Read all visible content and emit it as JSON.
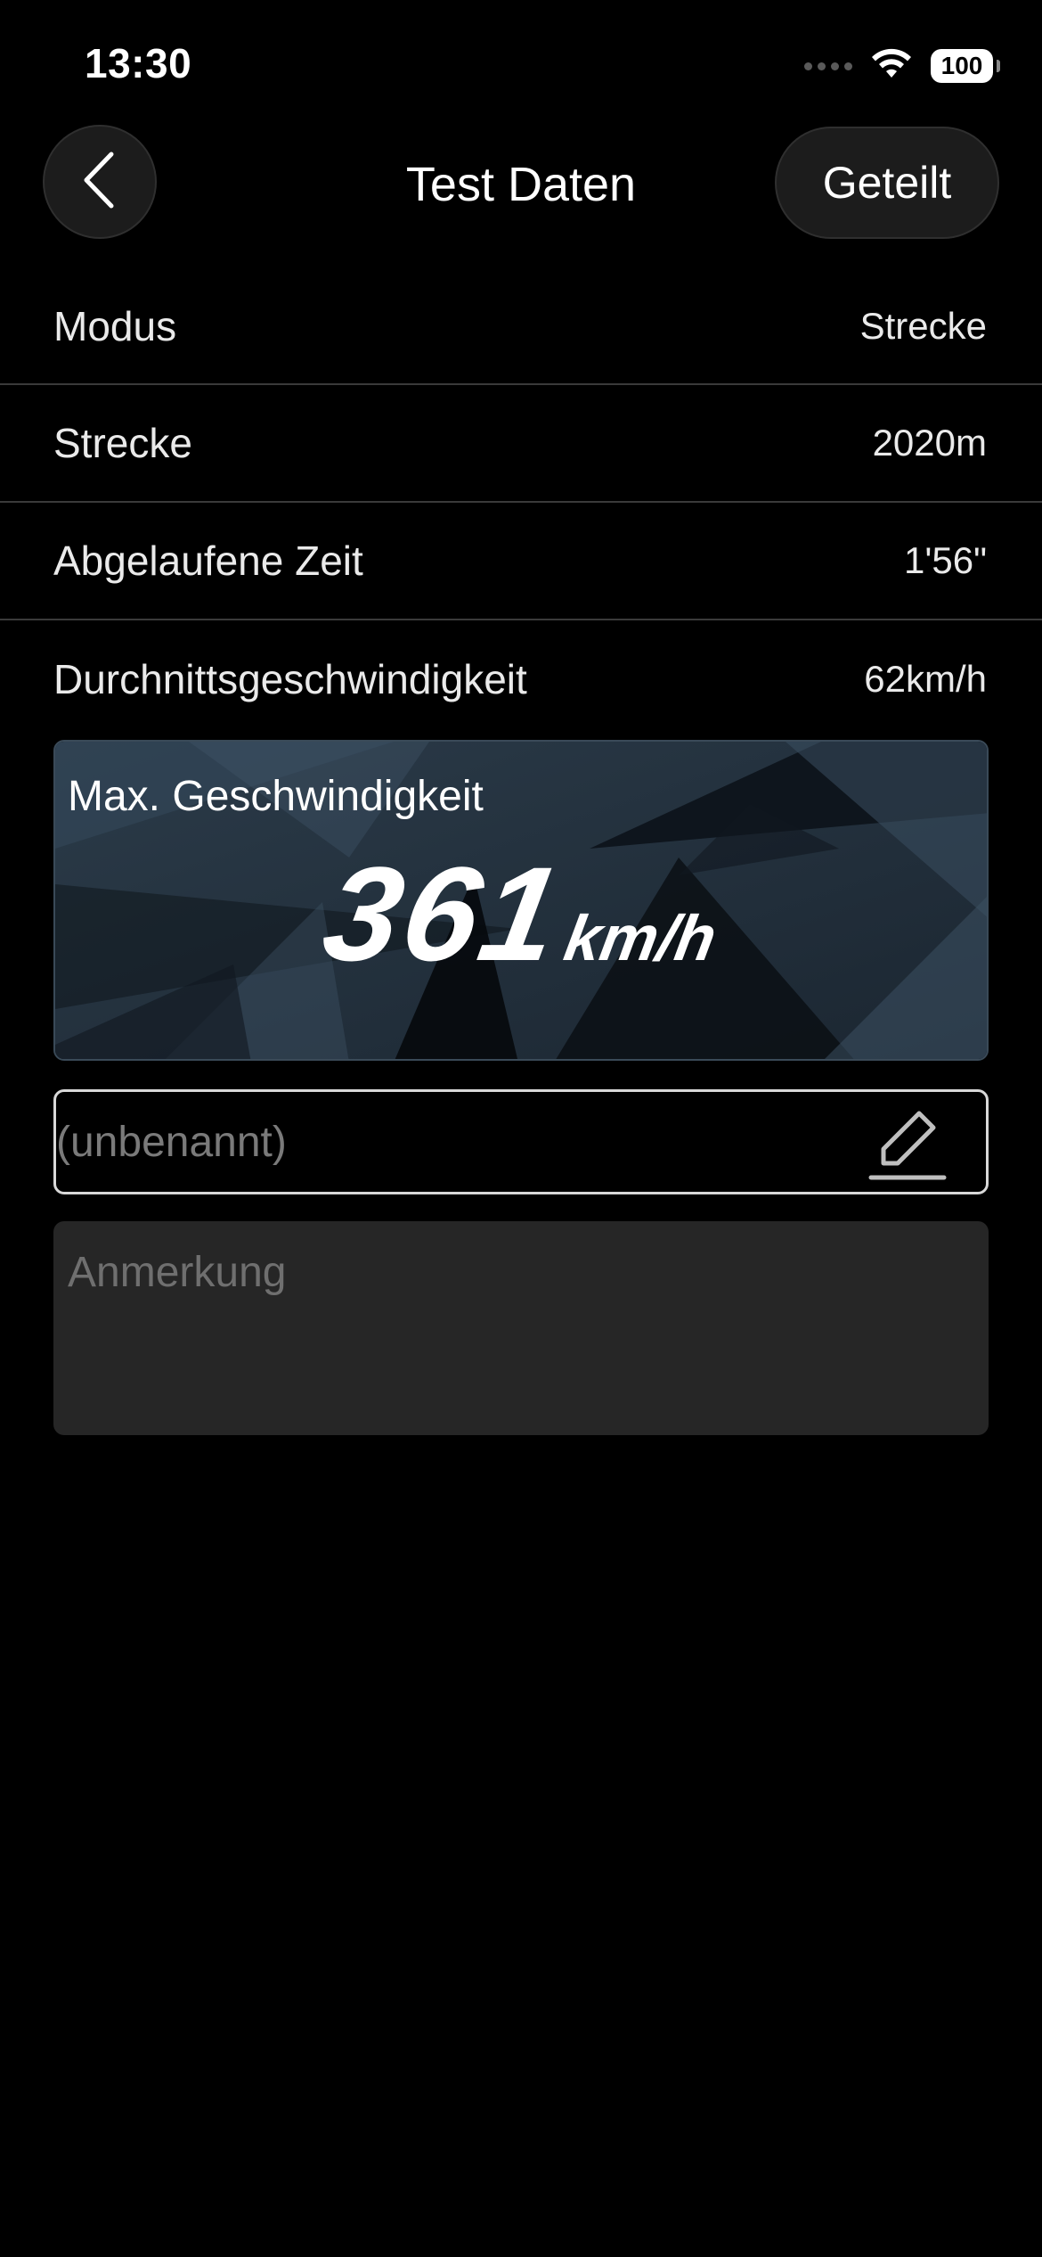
{
  "status_bar": {
    "time": "13:30",
    "battery": "100"
  },
  "nav": {
    "title": "Test Daten",
    "share_label": "Geteilt"
  },
  "rows": [
    {
      "label": "Modus",
      "value": "Strecke"
    },
    {
      "label": "Strecke",
      "value": "2020m"
    },
    {
      "label": "Abgelaufene Zeit",
      "value": "1'56\""
    },
    {
      "label": "Durchnittsgeschwindigkeit",
      "value": "62km/h"
    }
  ],
  "max_speed": {
    "label": "Max. Geschwindigkeit",
    "value": "361",
    "unit": "km/h"
  },
  "name_field": {
    "placeholder": "(unbenannt)"
  },
  "note_field": {
    "placeholder": "Anmerkung"
  },
  "colors": {
    "background": "#000000",
    "card_dark": "#1c1c1c",
    "speed_card_blue": "#2a3a48"
  },
  "icons": {
    "back": "chevron-left-icon",
    "edit": "pencil-icon",
    "wifi": "wifi-icon",
    "battery": "battery-icon"
  }
}
